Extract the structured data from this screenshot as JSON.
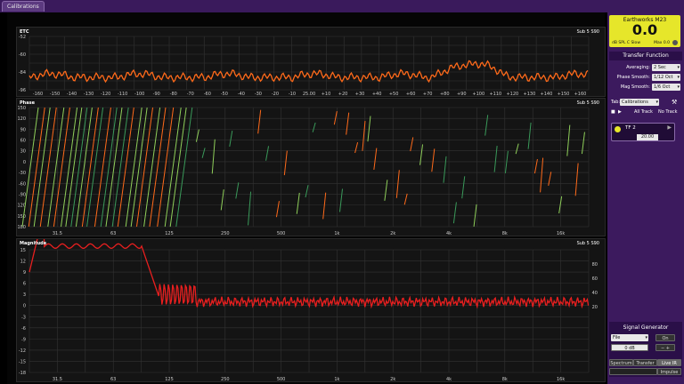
{
  "tab": {
    "label": "Calibrations"
  },
  "etc": {
    "title": "ETC",
    "info": "Sub 5 S90",
    "yticks": [
      "-52",
      "-60",
      "-84",
      "-96"
    ],
    "xticks": [
      "-160",
      "-150",
      "-140",
      "-130",
      "-120",
      "-110",
      "-100",
      "-90",
      "-80",
      "-70",
      "-60",
      "-50",
      "-40",
      "-30",
      "-20",
      "-10",
      "25.00",
      "+10",
      "+20",
      "+30",
      "+40",
      "+50",
      "+60",
      "+70",
      "+80",
      "+90",
      "+100",
      "+110",
      "+120",
      "+130",
      "+140",
      "+150",
      "+160"
    ]
  },
  "phase": {
    "title": "Phase",
    "info": "Sub 5 S90",
    "yticks": [
      "150",
      "120",
      "90",
      "60",
      "30",
      "0",
      "-30",
      "-60",
      "-90",
      "-120",
      "-150",
      "-180"
    ],
    "xticks": [
      "31.5",
      "63",
      "125",
      "250",
      "500",
      "1k",
      "2k",
      "4k",
      "8k",
      "16k"
    ]
  },
  "magnitude": {
    "title": "Magnitude",
    "info": "Sub 5 S90",
    "yticks": [
      "15",
      "12",
      "9",
      "6",
      "3",
      "0",
      "-3",
      "-6",
      "-9",
      "-12",
      "-15",
      "-18"
    ],
    "ryticks": [
      "80",
      "60",
      "40",
      "20"
    ],
    "xticks": [
      "31.5",
      "63",
      "125",
      "250",
      "500",
      "1k",
      "2k",
      "4k",
      "8k",
      "16k"
    ]
  },
  "colors": {
    "etc": "#ff6a1a",
    "magnitude": "#e81f1f",
    "phase_1": "#ff6a1a",
    "phase_2": "#8fcf5a",
    "phase_3": "#3a9a5a",
    "meter": "#e6e62a",
    "sidebar": "#3c1a5e"
  },
  "meter": {
    "name": "Earthworks M23",
    "value": "0.0",
    "mode": "dB SPL C Slow",
    "max": "Max 0.0"
  },
  "transfer": {
    "header": "Transfer Function",
    "averaging_label": "Averaging:",
    "averaging_value": "2 Sec",
    "phase_smooth_label": "Phase Smooth:",
    "phase_smooth_value": "1/12 Oct",
    "mag_smooth_label": "Mag Smooth:",
    "mag_smooth_value": "1/6 Oct",
    "tab_label": "Tab:",
    "tab_value": "Calibrations",
    "all_track": "All Track",
    "no_track": "No Track",
    "tf_name": "TF 2",
    "tf_delay": "20.00"
  },
  "signal": {
    "header": "Signal Generator",
    "source": "File",
    "level": "0 dB",
    "on_label": "On",
    "views": [
      "Spectrum",
      "Transfer",
      "Live IR"
    ],
    "impulse_label": "Impulse"
  }
}
